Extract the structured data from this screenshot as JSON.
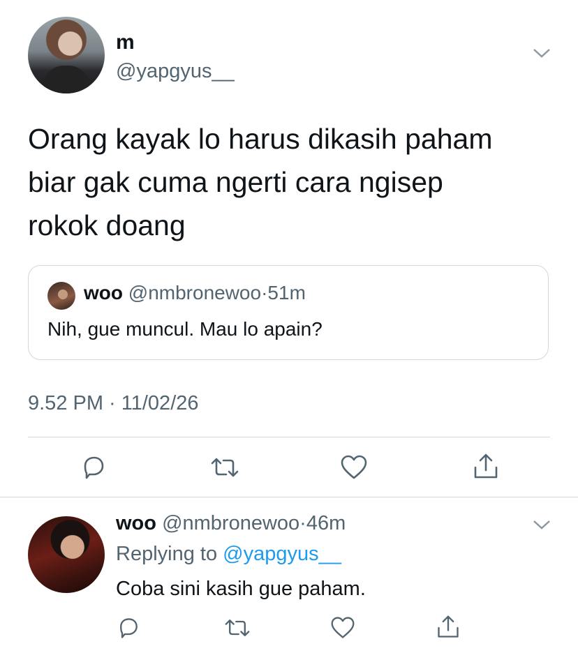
{
  "tweet": {
    "author_name": "m",
    "author_handle": "@yapgyus__",
    "text_lines": [
      "Orang kayak lo harus dikasih paham",
      "biar gak cuma ngerti cara ngisep",
      "rokok doang"
    ],
    "timestamp": "9.52 PM · 11/02/26",
    "menu_icon": "chevron-down-icon"
  },
  "quoted_tweet": {
    "author_name": "woo",
    "author_handle": "@nmbronewoo",
    "separator": "·",
    "time": "51m",
    "text": "Nih, gue muncul. Mau lo apain?"
  },
  "actions": [
    "reply-icon",
    "retweet-icon",
    "like-icon",
    "share-icon"
  ],
  "reply": {
    "author_name": "woo",
    "author_handle": "@nmbronewoo",
    "separator": "·",
    "time": "46m",
    "replying_prefix": "Replying to ",
    "replying_handle": "@yapgyus__",
    "text": "Coba sini kasih gue paham."
  },
  "colors": {
    "link": "#1d9bf0",
    "muted": "#536471",
    "border": "#cfd9de"
  }
}
